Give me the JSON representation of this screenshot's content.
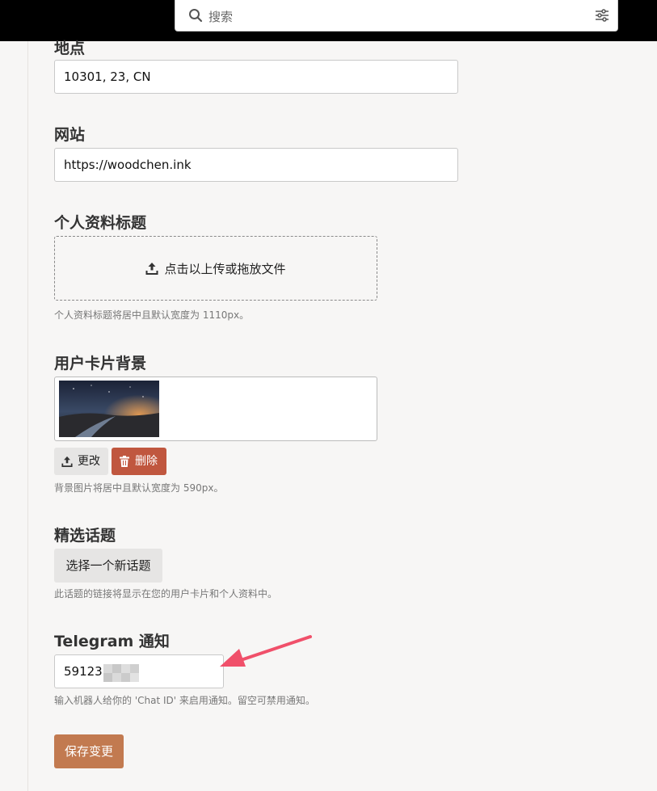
{
  "header": {
    "search_placeholder": "搜索"
  },
  "fields": {
    "location": {
      "label": "地点",
      "value": "10301, 23, CN"
    },
    "website": {
      "label": "网站",
      "value": "https://woodchen.ink"
    },
    "profile_header": {
      "label": "个人资料标题",
      "upload_text": "点击以上传或拖放文件",
      "help": "个人资料标题将居中且默认宽度为 1110px。"
    },
    "card_background": {
      "label": "用户卡片背景",
      "change_label": "更改",
      "delete_label": "删除",
      "help": "背景图片将居中且默认宽度为 590px。"
    },
    "featured_topic": {
      "label": "精选话题",
      "button_label": "选择一个新话题",
      "help": "此话题的链接将显示在您的用户卡片和个人资料中。"
    },
    "telegram": {
      "label": "Telegram 通知",
      "value": "59123",
      "help": "输入机器人给你的 'Chat ID' 来启用通知。留空可禁用通知。"
    }
  },
  "actions": {
    "save_label": "保存变更"
  },
  "colors": {
    "delete": "#c0573f",
    "save": "#c27a50",
    "annotation_arrow": "#f0506a"
  }
}
